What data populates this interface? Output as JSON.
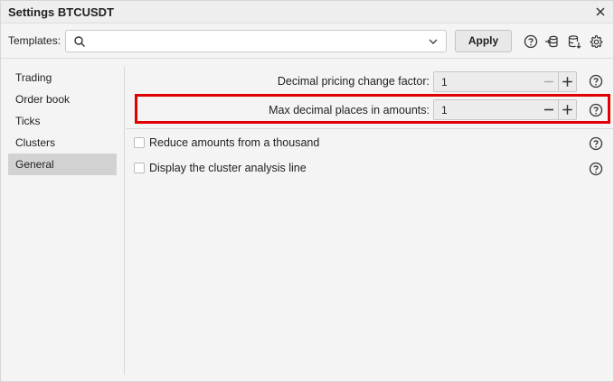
{
  "window": {
    "title": "Settings BTCUSDT"
  },
  "templates": {
    "label": "Templates:",
    "value": "",
    "apply_label": "Apply"
  },
  "sidebar": {
    "items": [
      {
        "label": "Trading"
      },
      {
        "label": "Order book"
      },
      {
        "label": "Ticks"
      },
      {
        "label": "Clusters"
      },
      {
        "label": "General",
        "active": true
      }
    ]
  },
  "general": {
    "decimal_pricing": {
      "label": "Decimal pricing change factor:",
      "value": "1"
    },
    "max_decimal": {
      "label": "Max decimal places in amounts:",
      "value": "1"
    },
    "reduce_amounts": {
      "label": "Reduce amounts from a thousand",
      "checked": false
    },
    "cluster_line": {
      "label": "Display the cluster analysis line",
      "checked": false
    }
  },
  "icons": {
    "close": "close-icon",
    "search": "search-icon",
    "chevron": "chevron-down-icon",
    "help": "help-icon",
    "import": "import-icon",
    "export": "export-icon",
    "settings": "gear-icon",
    "minus": "minus-icon",
    "plus": "plus-icon"
  },
  "colors": {
    "highlight": "#e00000",
    "active_item": "#d2d2d2",
    "background": "#f4f4f4"
  }
}
